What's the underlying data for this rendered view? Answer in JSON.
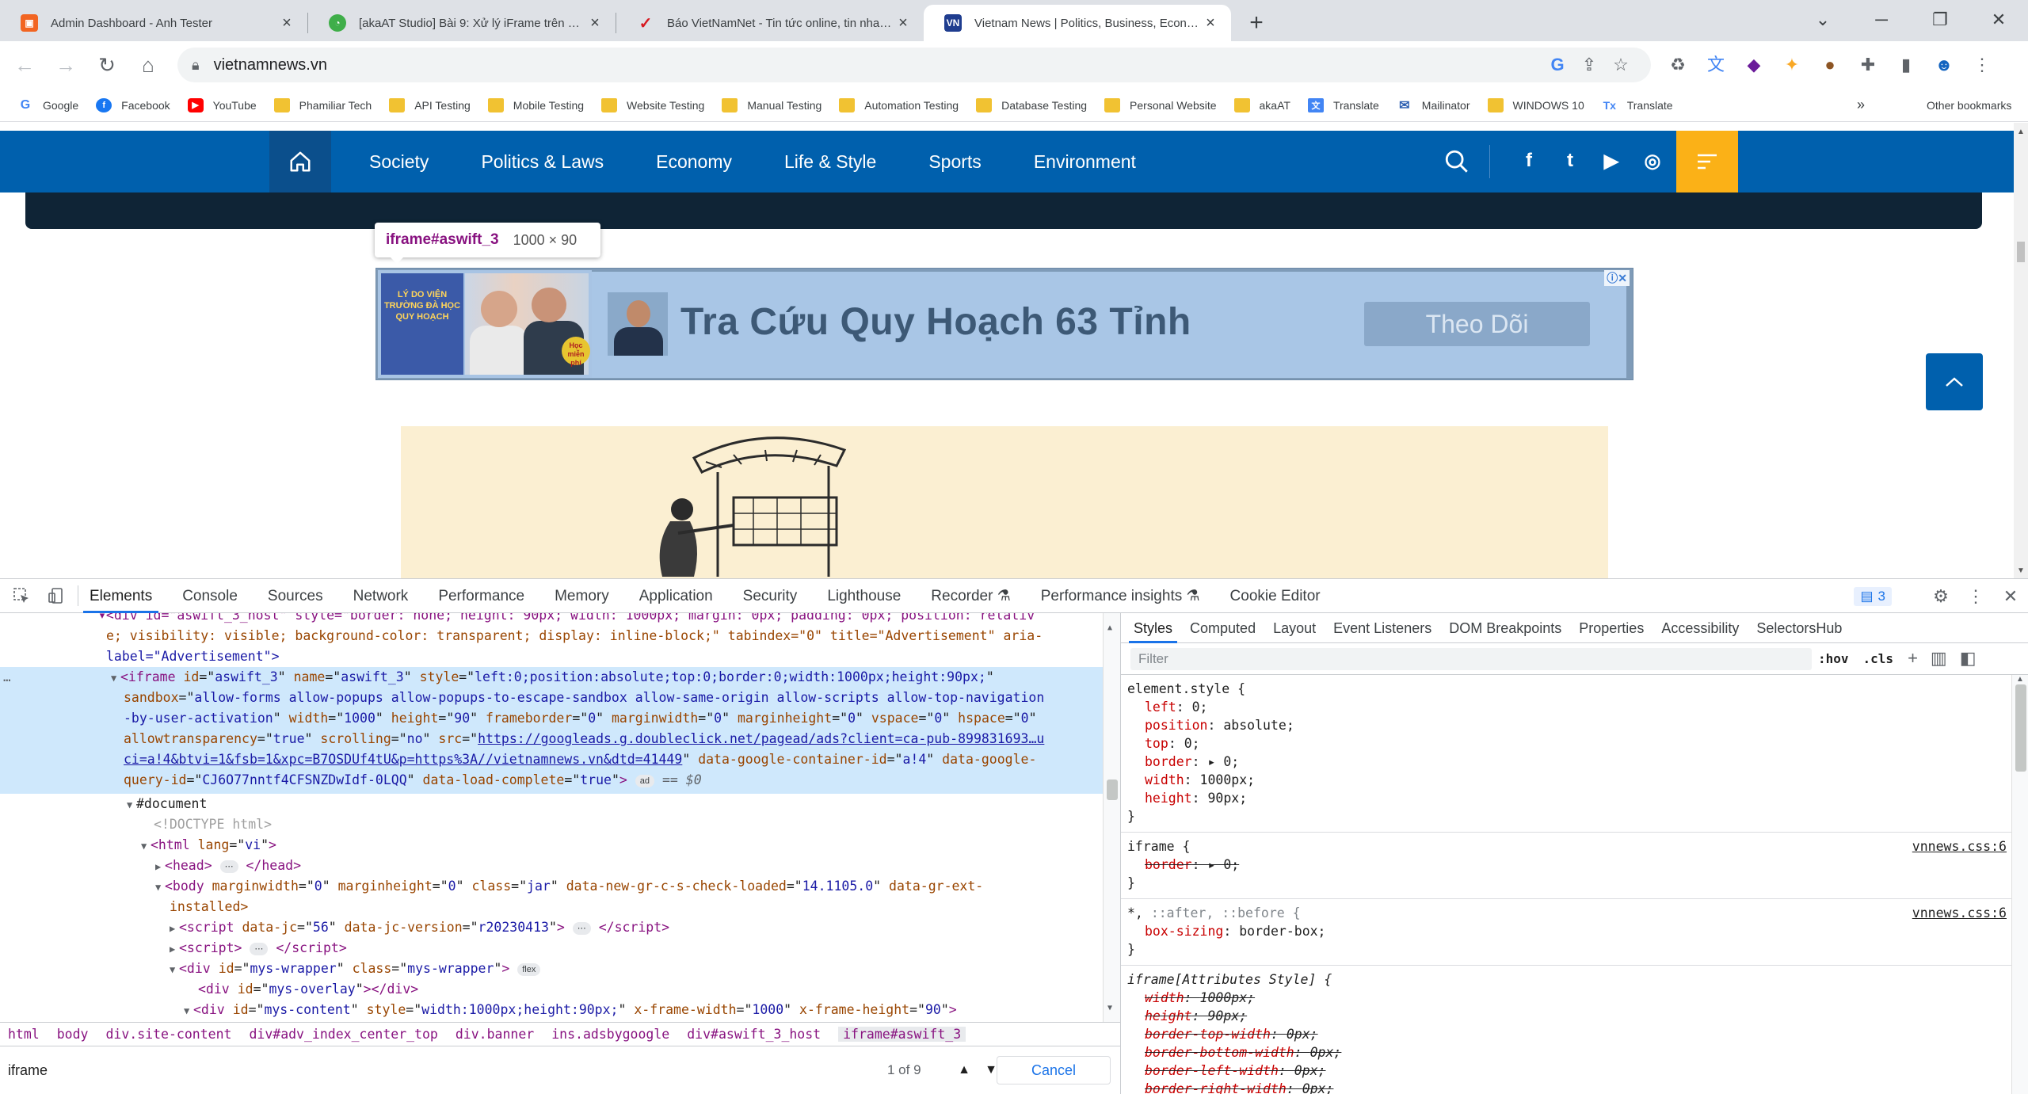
{
  "browser": {
    "tabs": [
      {
        "title": "Admin Dashboard - Anh Tester",
        "favicon": "anhtester-icon",
        "color": "#f26522"
      },
      {
        "title": "[akaAT Studio] Bài 9: Xử lý iFrame trên website",
        "favicon": "akaat-icon",
        "color": "#3fae49"
      },
      {
        "title": "Báo VietNamNet - Tin tức online, tin nhanh Việt Nam",
        "favicon": "vietnamnet-icon",
        "color": "#d71920"
      },
      {
        "title": "Vietnam News | Politics, Business, Economy, Society",
        "favicon": "vietnamnews-icon",
        "color": "#1f3d8f"
      }
    ],
    "new_tab": "+",
    "url": "vietnamnews.vn",
    "bookmarks": [
      {
        "label": "Google",
        "kind": "google"
      },
      {
        "label": "Facebook",
        "kind": "facebook"
      },
      {
        "label": "YouTube",
        "kind": "youtube"
      },
      {
        "label": "Phamiliar Tech",
        "kind": "folder"
      },
      {
        "label": "API Testing",
        "kind": "folder"
      },
      {
        "label": "Mobile Testing",
        "kind": "folder"
      },
      {
        "label": "Website Testing",
        "kind": "folder"
      },
      {
        "label": "Manual Testing",
        "kind": "folder"
      },
      {
        "label": "Automation Testing",
        "kind": "folder"
      },
      {
        "label": "Database Testing",
        "kind": "folder"
      },
      {
        "label": "Personal Website",
        "kind": "folder"
      },
      {
        "label": "akaAT",
        "kind": "folder"
      },
      {
        "label": "Translate",
        "kind": "translate"
      },
      {
        "label": "Mailinator",
        "kind": "mail"
      },
      {
        "label": "WINDOWS 10",
        "kind": "folder"
      },
      {
        "label": "Translate",
        "kind": "translate2"
      }
    ],
    "bookmarks_more": "»",
    "other_bookmarks": "Other bookmarks"
  },
  "site": {
    "nav": [
      "Society",
      "Politics & Laws",
      "Economy",
      "Life & Style",
      "Sports",
      "Environment"
    ],
    "social": [
      "f",
      "t",
      "▶",
      "◎"
    ],
    "tooltip": {
      "selector": "iframe#aswift_3",
      "size": "1000 × 90"
    },
    "ad": {
      "poster_text": "LÝ DO VIỆN TRƯỜNG ĐÀ HỌC QUY HOẠCH",
      "badge": "Học miễn phí",
      "title": "Tra Cứu Quy Hoạch 63 Tỉnh",
      "cta": "Theo Dõi",
      "info": "ⓘ✕"
    }
  },
  "devtools": {
    "tabs": [
      "Elements",
      "Console",
      "Sources",
      "Network",
      "Performance",
      "Memory",
      "Application",
      "Security",
      "Lighthouse",
      "Recorder ⚗",
      "Performance insights ⚗",
      "Cookie Editor"
    ],
    "issues_count": "3",
    "elements": {
      "l0": "▾<div id=\"aswift_3_host\" style=\"border: none; height: 90px; width: 1000px; margin: 0px; padding: 0px; position: relativ",
      "l1": "e; visibility: visible; background-color: transparent; display: inline-block;\" tabindex=\"0\" title=\"Advertisement\" aria-",
      "l2": "label=\"Advertisement\">",
      "iframe": {
        "open": "<iframe",
        "id": "aswift_3",
        "name": "aswift_3",
        "style": "left:0;position:absolute;top:0;border:0;width:1000px;height:90px;",
        "sandbox": "allow-forms allow-popups allow-popups-to-escape-sandbox allow-same-origin allow-scripts allow-top-navigation",
        "sandbox2": "-by-user-activation",
        "width": "1000",
        "height": "90",
        "frameborder": "0",
        "marginwidth": "0",
        "marginheight": "0",
        "vspace": "0",
        "hspace": "0",
        "allowtransparency": "true",
        "scrolling": "no",
        "src1": "https://googleads.g.doubleclick.net/pagead/ads?client=ca-pub-899831693…u",
        "src2": "ci=a!4&btvi=1&fsb=1&xpc=B7OSDUf4tU&p=https%3A//vietnamnews.vn&dtd=41449",
        "container": "a!4",
        "query_id": "CJ6O77nntf4CFSNZDwIdf-0LQQ",
        "load_complete": "true",
        "pill": "ad",
        "eq": "== $0"
      },
      "document": "#document",
      "doctype": "<!DOCTYPE html>",
      "html_lang": "vi",
      "head": "head",
      "body_attrs": {
        "marginwidth": "0",
        "marginheight": "0",
        "class": "jar",
        "check": "14.1105.0"
      },
      "body_tail": "installed>",
      "script1": {
        "jc": "56",
        "ver": "r20230413"
      },
      "wrapper": {
        "id": "mys-wrapper",
        "class": "mys-wrapper",
        "pill": "flex"
      },
      "overlay": "mys-overlay",
      "content": {
        "id": "mys-content",
        "style": "width:1000px;height:90px;",
        "fw": "1000",
        "fh": "90"
      }
    },
    "breadcrumbs": [
      "html",
      "body",
      "div.site-content",
      "div#adv_index_center_top",
      "div.banner",
      "ins.adsbygoogle",
      "div#aswift_3_host",
      "iframe#aswift_3"
    ],
    "search": {
      "value": "iframe",
      "count": "1 of 9",
      "cancel": "Cancel"
    },
    "styles_tabs": [
      "Styles",
      "Computed",
      "Layout",
      "Event Listeners",
      "DOM Breakpoints",
      "Properties",
      "Accessibility",
      "SelectorsHub"
    ],
    "filter_placeholder": "Filter",
    "filter_hov": ":hov",
    "filter_cls": ".cls",
    "rules": {
      "element_style": {
        "selector": "element.style {",
        "decls": [
          {
            "p": "left",
            "v": "0;"
          },
          {
            "p": "position",
            "v": "absolute;"
          },
          {
            "p": "top",
            "v": "0;"
          },
          {
            "p": "border",
            "v": "▸ 0;"
          },
          {
            "p": "width",
            "v": "1000px;"
          },
          {
            "p": "height",
            "v": "90px;"
          }
        ]
      },
      "iframe_rule": {
        "selector": "iframe {",
        "src": "vnnews.css:6",
        "p": "border",
        "v": "▸ 0;"
      },
      "universal": {
        "selector_a": "*,",
        "selector_b": "::after, ::before {",
        "src": "vnnews.css:6",
        "p": "box-sizing",
        "v": "border-box;"
      },
      "attr_style": {
        "selector": "iframe[Attributes Style] {",
        "decls": [
          {
            "p": "width",
            "v": "1000px;"
          },
          {
            "p": "height",
            "v": "90px;"
          },
          {
            "p": "border-top-width",
            "v": "0px;"
          },
          {
            "p": "border-bottom-width",
            "v": "0px;"
          },
          {
            "p": "border-left-width",
            "v": "0px;"
          },
          {
            "p": "border-right-width",
            "v": "0px;"
          }
        ]
      },
      "close": "}"
    }
  }
}
